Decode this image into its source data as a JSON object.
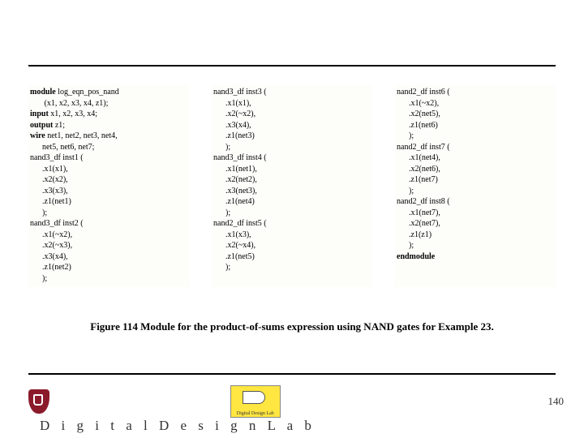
{
  "code": {
    "col1": [
      {
        "b": "module",
        "t": " log_eqn_pos_nand"
      },
      {
        "b": "",
        "t": "       (x1, x2, x3, x4, z1);"
      },
      {
        "b": "input",
        "t": " x1, x2, x3, x4;"
      },
      {
        "b": "output",
        "t": " z1;"
      },
      {
        "b": "wire",
        "t": " net1, net2, net3, net4,"
      },
      {
        "b": "",
        "t": "      net5, net6, net7;"
      },
      {
        "b": "",
        "t": "nand3_df inst1 ("
      },
      {
        "b": "",
        "t": "      .x1(x1),"
      },
      {
        "b": "",
        "t": "      .x2(x2),"
      },
      {
        "b": "",
        "t": "      .x3(x3),"
      },
      {
        "b": "",
        "t": "      .z1(net1)"
      },
      {
        "b": "",
        "t": "      );"
      },
      {
        "b": "",
        "t": "nand3_df inst2 ("
      },
      {
        "b": "",
        "t": "      .x1(~x2),"
      },
      {
        "b": "",
        "t": "      .x2(~x3),"
      },
      {
        "b": "",
        "t": "      .x3(x4),"
      },
      {
        "b": "",
        "t": "      .z1(net2)"
      },
      {
        "b": "",
        "t": "      );"
      }
    ],
    "col2": [
      {
        "b": "",
        "t": "nand3_df inst3 ("
      },
      {
        "b": "",
        "t": "      .x1(x1),"
      },
      {
        "b": "",
        "t": "      .x2(~x2),"
      },
      {
        "b": "",
        "t": "      .x3(x4),"
      },
      {
        "b": "",
        "t": "      .z1(net3)"
      },
      {
        "b": "",
        "t": "      );"
      },
      {
        "b": "",
        "t": "nand3_df inst4 ("
      },
      {
        "b": "",
        "t": "      .x1(net1),"
      },
      {
        "b": "",
        "t": "      .x2(net2),"
      },
      {
        "b": "",
        "t": "      .x3(net3),"
      },
      {
        "b": "",
        "t": "      .z1(net4)"
      },
      {
        "b": "",
        "t": "      );"
      },
      {
        "b": "",
        "t": "nand2_df inst5 ("
      },
      {
        "b": "",
        "t": "      .x1(x3),"
      },
      {
        "b": "",
        "t": "      .x2(~x4),"
      },
      {
        "b": "",
        "t": "      .z1(net5)"
      },
      {
        "b": "",
        "t": "      );"
      }
    ],
    "col3": [
      {
        "b": "",
        "t": "nand2_df inst6 ("
      },
      {
        "b": "",
        "t": "      .x1(~x2),"
      },
      {
        "b": "",
        "t": "      .x2(net5),"
      },
      {
        "b": "",
        "t": "      .z1(net6)"
      },
      {
        "b": "",
        "t": "      );"
      },
      {
        "b": "",
        "t": "nand2_df inst7 ("
      },
      {
        "b": "",
        "t": "      .x1(net4),"
      },
      {
        "b": "",
        "t": "      .x2(net6),"
      },
      {
        "b": "",
        "t": "      .z1(net7)"
      },
      {
        "b": "",
        "t": "      );"
      },
      {
        "b": "",
        "t": "nand2_df inst8 ("
      },
      {
        "b": "",
        "t": "      .x1(net7),"
      },
      {
        "b": "",
        "t": "      .x2(net7),"
      },
      {
        "b": "",
        "t": "      .z1(z1)"
      },
      {
        "b": "",
        "t": "      );"
      },
      {
        "b": "endmodule",
        "t": ""
      }
    ]
  },
  "caption": "Figure 114 Module for the product-of-sums expression using NAND gates for Example 23.",
  "footer": {
    "chip_label": "Digital Design Lab",
    "lab_title": "D i g i t a l   D e s i g n   L a b",
    "page": "140"
  }
}
